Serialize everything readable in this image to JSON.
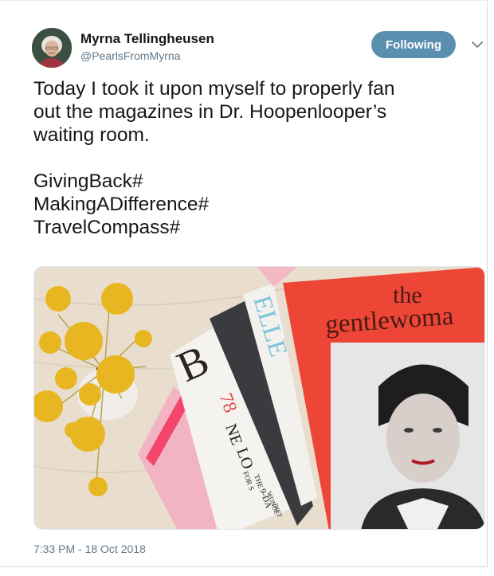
{
  "tweet": {
    "author": {
      "display_name": "Myrna Tellingheusen",
      "handle": "@PearlsFromMyrna"
    },
    "follow_button_label": "Following",
    "text_lines": [
      "Today I took it upon myself to properly fan",
      "out the magazines in Dr. Hoopenlooper’s",
      "waiting room."
    ],
    "hashtag_lines": [
      "GivingBack#",
      "MakingADifference#",
      "TravelCompass#"
    ],
    "timestamp": "7:33 PM - 18 Oct 2018"
  },
  "media": {
    "magazine_cover_title_line1": "the",
    "magazine_cover_title_line2": "gentlewoma",
    "elle_letters": "ELLE",
    "cover_b": "B",
    "cover_78": "78",
    "cover_ne": "NE",
    "cover_lo": "LO",
    "cover_for_s": "FOR S",
    "cover_the": "THE",
    "cover_9day": "9-DA",
    "cover_wonde": "WONDE",
    "cover_diet": "DIET"
  },
  "colors": {
    "follow_button": "#5b8fb0",
    "magazine_red": "#f0493a",
    "flower_yellow": "#e9b923",
    "table_wood": "#e8dccb"
  },
  "icons": {
    "chevron": "chevron-down-icon"
  }
}
